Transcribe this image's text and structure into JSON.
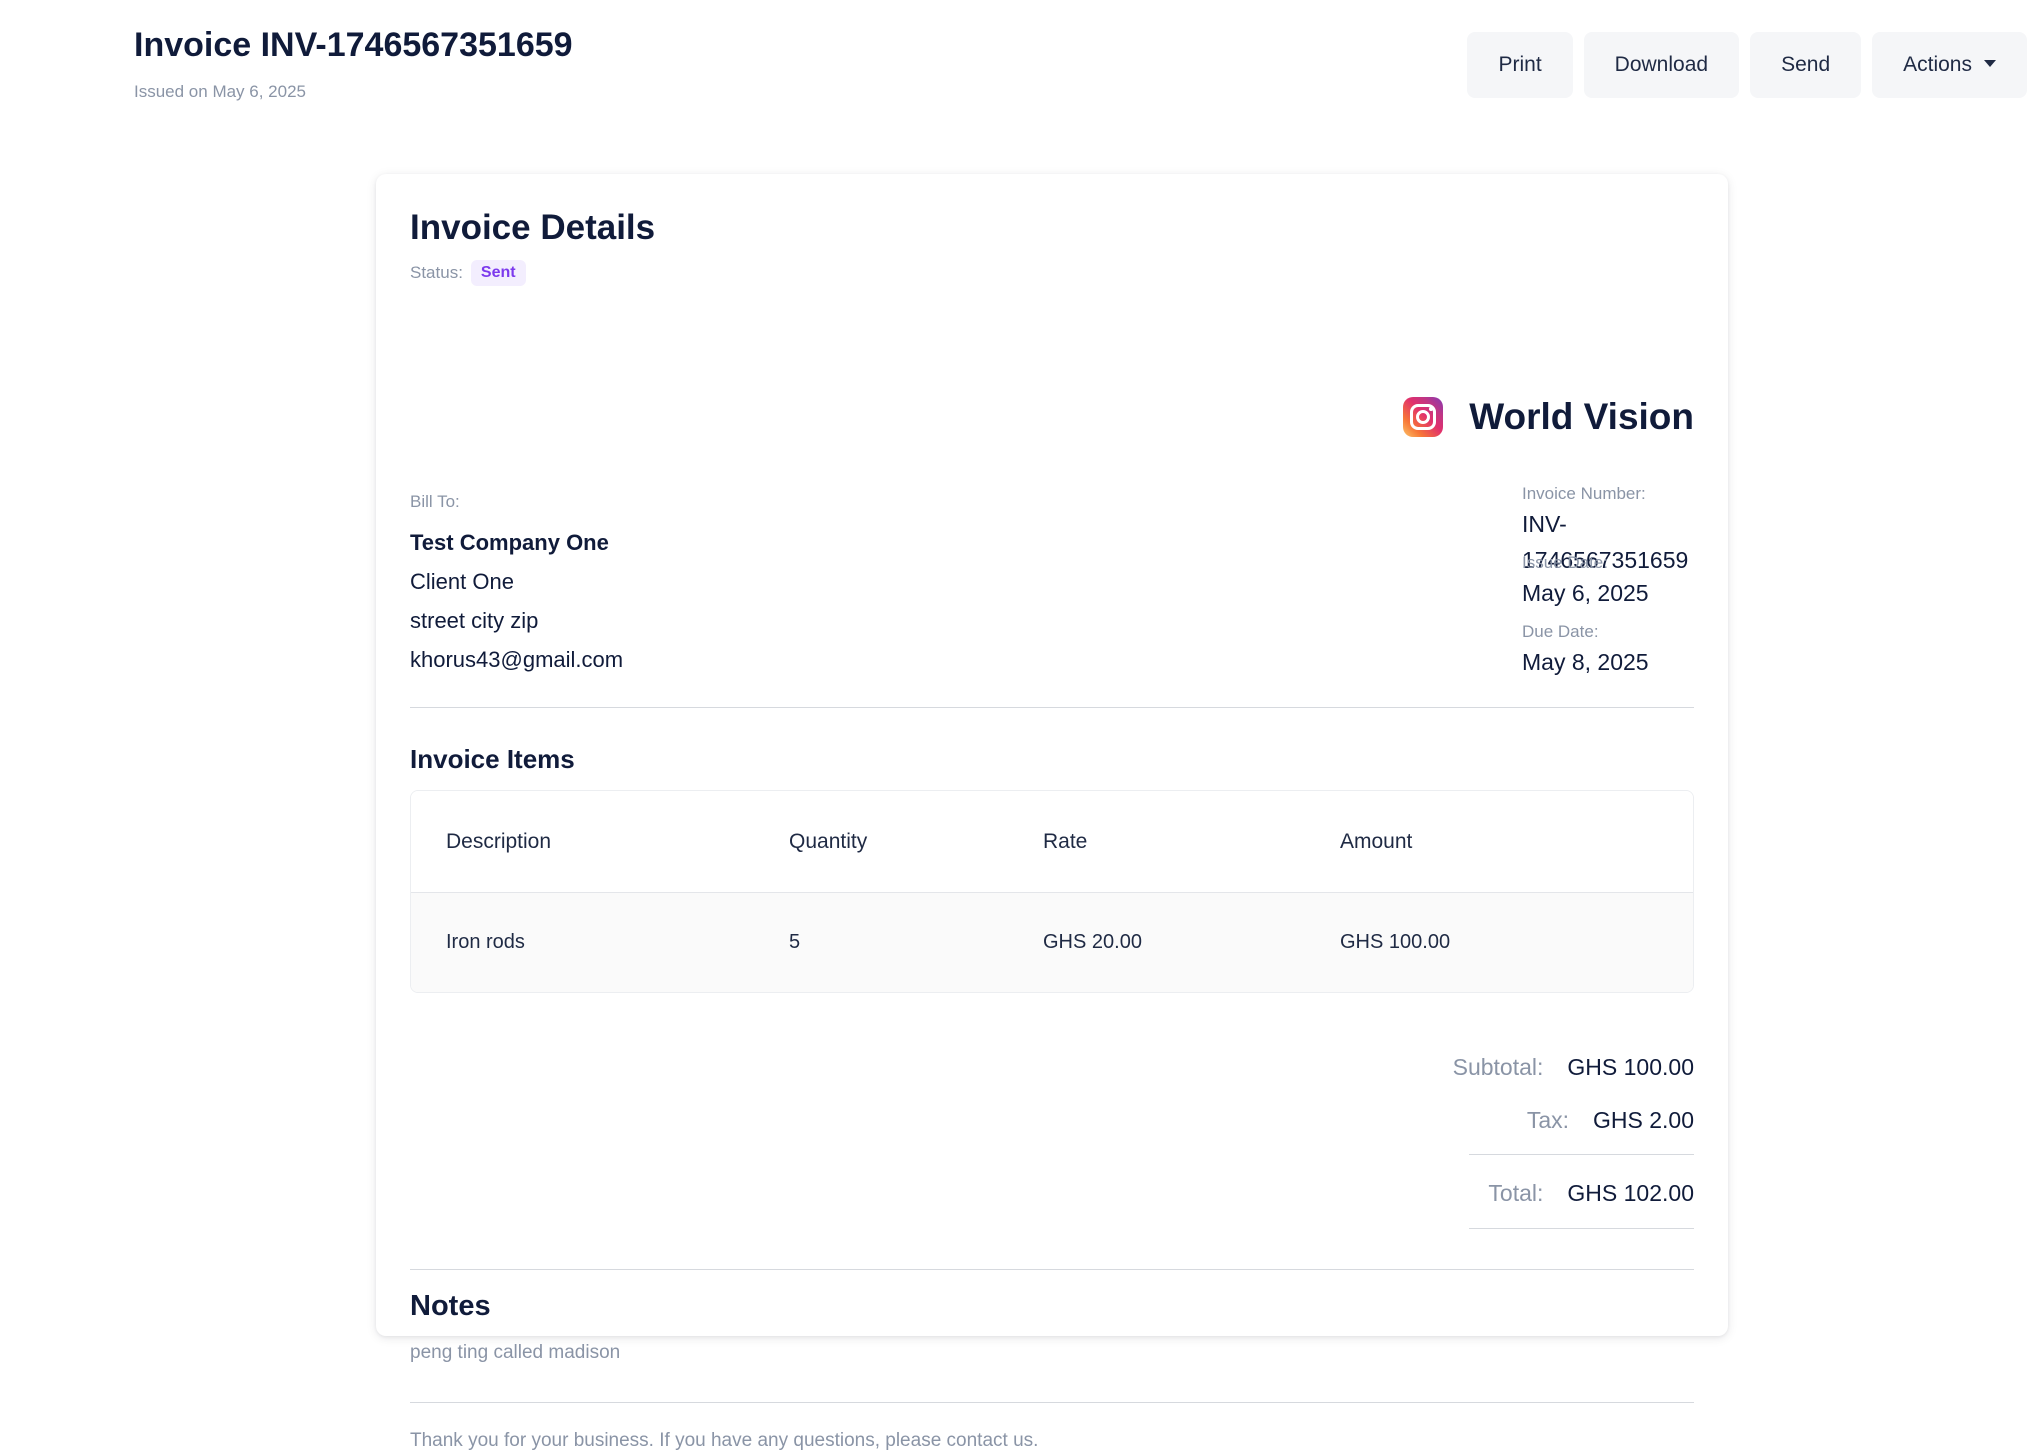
{
  "header": {
    "title": "Invoice INV-1746567351659",
    "subtitle": "Issued on May 6, 2025"
  },
  "toolbar": {
    "print_label": "Print",
    "download_label": "Download",
    "send_label": "Send",
    "actions_label": "Actions"
  },
  "details": {
    "title": "Invoice Details",
    "status_label": "Status:",
    "status_value": "Sent",
    "status_color": "#7c3aed"
  },
  "bill_to": {
    "label": "Bill To:",
    "company": "Test Company One",
    "name": "Client One",
    "address": "street city zip",
    "email": "khorus43@gmail.com"
  },
  "brand": {
    "icon": "instagram-icon",
    "name": "World Vision"
  },
  "meta": {
    "invoice_number_label": "Invoice Number:",
    "invoice_number": "INV-1746567351659",
    "issue_date_label": "Issue Date:",
    "issue_date": "May 6, 2025",
    "due_date_label": "Due Date:",
    "due_date": "May 8, 2025"
  },
  "items": {
    "title": "Invoice Items",
    "columns": [
      "Description",
      "Quantity",
      "Rate",
      "Amount"
    ],
    "rows": [
      [
        "Iron rods",
        "5",
        "GHS 20.00",
        "GHS 100.00"
      ]
    ]
  },
  "totals": {
    "subtotal_label": "Subtotal:",
    "subtotal": "GHS 100.00",
    "tax_label": "Tax:",
    "tax": "GHS 2.00",
    "total_label": "Total:",
    "total": "GHS 102.00"
  },
  "notes": {
    "title": "Notes",
    "text": "peng ting called madison"
  },
  "footer": {
    "text": "Thank you for your business. If you have any questions, please contact us."
  }
}
